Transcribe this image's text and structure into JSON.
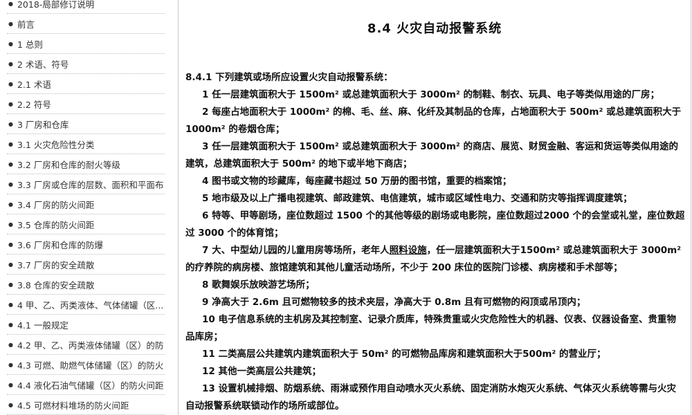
{
  "sidebar": {
    "items": [
      "2018-局部修订说明",
      "前言",
      "1 总则",
      "2 术语、符号",
      "2.1 术语",
      "2.2 符号",
      "3 厂房和仓库",
      "3.1 火灾危险性分类",
      "3.2 厂房和仓库的耐火等级",
      "3.3 厂房或仓库的层数、面积和平面布",
      "3.4 厂房的防火间距",
      "3.5 仓库的防火间距",
      "3.6 厂房和仓库的防爆",
      "3.7 厂房的安全疏散",
      "3.8 仓库的安全疏散",
      "4 甲、乙、丙类液体、气体储罐（区...",
      "4.1 一般规定",
      "4.2 甲、乙、丙类液体储罐（区）的防",
      "4.3 可燃、助燃气体储罐（区）的防火",
      "4.4 液化石油气储罐（区）的防火间距",
      "4.5 可燃材料堆场的防火间距"
    ]
  },
  "content": {
    "title": "8.4  火灾自动报警系统",
    "lead": "8.4.1  下列建筑或场所应设置火灾自动报警系统：",
    "item1": "1  任一层建筑面积大于 1500m² 或总建筑面积大于 3000m² 的制鞋、制衣、玩具、电子等类似用途的厂房；",
    "item2": "2 每座占地面积大于 1000m² 的棉、毛、丝、麻、化纤及其制品的仓库，占地面积大于 500m² 或总建筑面积大于 1000m² 的卷烟仓库；",
    "item3": "3 任一层建筑面积大于 1500m² 或总建筑面积大于 3000m² 的商店、展览、财贸金融、客运和货运等类似用途的建筑，总建筑面积大于 500m² 的地下或半地下商店；",
    "item4": "4 图书或文物的珍藏库，每座藏书超过 50 万册的图书馆，重要的档案馆；",
    "item5": "5 地市级及以上广播电视建筑、邮政建筑、电信建筑，城市或区域性电力、交通和防灾等指挥调度建筑；",
    "item6": "6 特等、甲等剧场，座位数超过 1500 个的其他等级的剧场或电影院，座位数超过2000 个的会堂或礼堂，座位数超过 3000 个的体育馆；",
    "item7_a": "7 大、中型幼儿园的儿童用房等场所，老年人",
    "item7_link": "照料设施",
    "item7_b": "，任一层建筑面积大于1500m² 或总建筑面积大于 3000m² 的疗养院的病房楼、旅馆建筑和其他儿童活动场所，不少于 200 床位的医院门诊楼、病房楼和手术部等；",
    "item8": "8 歌舞娱乐放映游艺场所；",
    "item9": "9 净高大于 2.6m 且可燃物较多的技术夹层，净高大于 0.8m 且有可燃物的闷顶或吊顶内；",
    "item10": "10 电子信息系统的主机房及其控制室、记录介质库，特殊贵重或火灾危险性大的机器、仪表、仪器设备室、贵重物品库房；",
    "item11": "11 二类高层公共建筑内建筑面积大于 50m²  的可燃物品库房和建筑面积大于500m² 的营业厅；",
    "item12": "12 其他一类高层公共建筑；",
    "item13": "13 设置机械排烟、防烟系统、雨淋或预作用自动喷水灭火系统、固定消防水炮灭火系统、气体灭火系统等需与火灾自动报警系统联锁动作的场所或部位。"
  }
}
